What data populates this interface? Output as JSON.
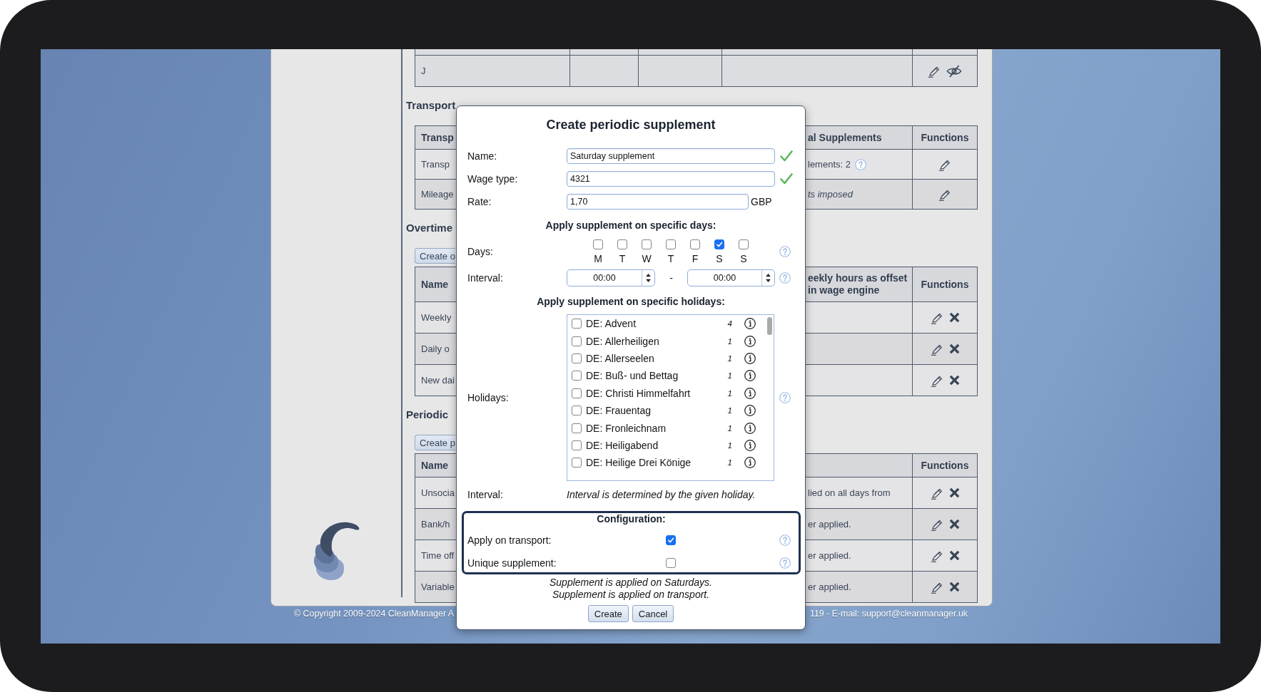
{
  "top_table": {
    "rows": [
      {
        "first_cell": "J",
        "actions": [
          {
            "kind": "edit"
          },
          {
            "kind": "hide"
          }
        ]
      }
    ]
  },
  "sections": [
    {
      "heading": "Transport",
      "table": {
        "header": {
          "first_cell": "Transp",
          "right_cell": "al Supplements",
          "functions": "Functions"
        },
        "rows": [
          {
            "first_cell": "Transp",
            "right_cell": "lements: 2",
            "right_help": true,
            "right_note": false,
            "actions": [
              {
                "kind": "edit"
              }
            ]
          },
          {
            "first_cell": "Mileage",
            "right_cell": "ts imposed",
            "right_help": false,
            "right_note": true,
            "actions": [
              {
                "kind": "edit"
              }
            ]
          }
        ]
      }
    },
    {
      "heading": "Overtime",
      "create_button": "Create o",
      "table": {
        "header": {
          "first_cell": "Name",
          "right_cell": "eekly hours as offset in wage engine",
          "functions": "Functions"
        },
        "rows": [
          {
            "first_cell": "Weekly",
            "actions": [
              {
                "kind": "edit"
              },
              {
                "kind": "delete"
              }
            ]
          },
          {
            "first_cell": "Daily o",
            "actions": [
              {
                "kind": "edit"
              },
              {
                "kind": "delete"
              }
            ]
          },
          {
            "first_cell": "New dai",
            "actions": [
              {
                "kind": "edit"
              },
              {
                "kind": "delete"
              }
            ]
          }
        ]
      }
    },
    {
      "heading": "Periodic",
      "create_button": "Create p",
      "table": {
        "header": {
          "first_cell": "Name",
          "functions": "Functions"
        },
        "rows": [
          {
            "first_cell": "Unsocia",
            "right_cell": "lied on all days from",
            "actions": [
              {
                "kind": "edit"
              },
              {
                "kind": "delete"
              }
            ]
          },
          {
            "first_cell": "Bank/h",
            "right_cell": "er applied.",
            "actions": [
              {
                "kind": "edit"
              },
              {
                "kind": "delete"
              }
            ]
          },
          {
            "first_cell": "Time off",
            "right_cell": "er applied.",
            "actions": [
              {
                "kind": "edit"
              },
              {
                "kind": "delete"
              }
            ]
          },
          {
            "first_cell": "Variable",
            "right_cell": "er applied.",
            "actions": [
              {
                "kind": "edit"
              },
              {
                "kind": "delete"
              }
            ]
          }
        ]
      }
    }
  ],
  "footer": {
    "copyright": "© Copyright 2009-2024 CleanManager A",
    "contact": "119 - E-mail: support@cleanmanager.uk"
  },
  "dialog": {
    "title": "Create periodic supplement",
    "fields": [
      {
        "label": "Name:",
        "value": "Saturday supplement",
        "valid": true
      },
      {
        "label": "Wage type:",
        "value": "4321",
        "valid": true
      },
      {
        "label": "Rate:",
        "value": "1,70",
        "unit": "GBP",
        "valid": false
      }
    ],
    "days_heading": "Apply supplement on specific days:",
    "days": {
      "label": "Days:",
      "items": [
        {
          "letter": "M",
          "checked": false
        },
        {
          "letter": "T",
          "checked": false
        },
        {
          "letter": "W",
          "checked": false
        },
        {
          "letter": "T",
          "checked": false
        },
        {
          "letter": "F",
          "checked": false
        },
        {
          "letter": "S",
          "checked": true
        },
        {
          "letter": "S",
          "checked": false
        }
      ]
    },
    "interval": {
      "label": "Interval:",
      "from": "00:00",
      "separator": "-",
      "to": "00:00"
    },
    "holidays_heading": "Apply supplement on specific holidays:",
    "holidays": {
      "label": "Holidays:",
      "items": [
        {
          "name": "DE: Advent",
          "count": "4",
          "checked": false
        },
        {
          "name": "DE: Allerheiligen",
          "count": "1",
          "checked": false
        },
        {
          "name": "DE: Allerseelen",
          "count": "1",
          "checked": false
        },
        {
          "name": "DE: Buß- und Bettag",
          "count": "1",
          "checked": false
        },
        {
          "name": "DE: Christi Himmelfahrt",
          "count": "1",
          "checked": false
        },
        {
          "name": "DE: Frauentag",
          "count": "1",
          "checked": false
        },
        {
          "name": "DE: Fronleichnam",
          "count": "1",
          "checked": false
        },
        {
          "name": "DE: Heiligabend",
          "count": "1",
          "checked": false
        },
        {
          "name": "DE: Heilige Drei Könige",
          "count": "1",
          "checked": false
        }
      ]
    },
    "holiday_interval": {
      "label": "Interval:",
      "note": "Interval is determined by the given holiday."
    },
    "configuration": {
      "title": "Configuration:",
      "options": [
        {
          "label": "Apply on transport:",
          "checked": true
        },
        {
          "label": "Unique supplement:",
          "checked": false
        }
      ]
    },
    "summary": [
      "Supplement is applied on Saturdays.",
      "Supplement is applied on transport."
    ],
    "buttons": [
      {
        "label": "Create"
      },
      {
        "label": "Cancel"
      }
    ]
  }
}
